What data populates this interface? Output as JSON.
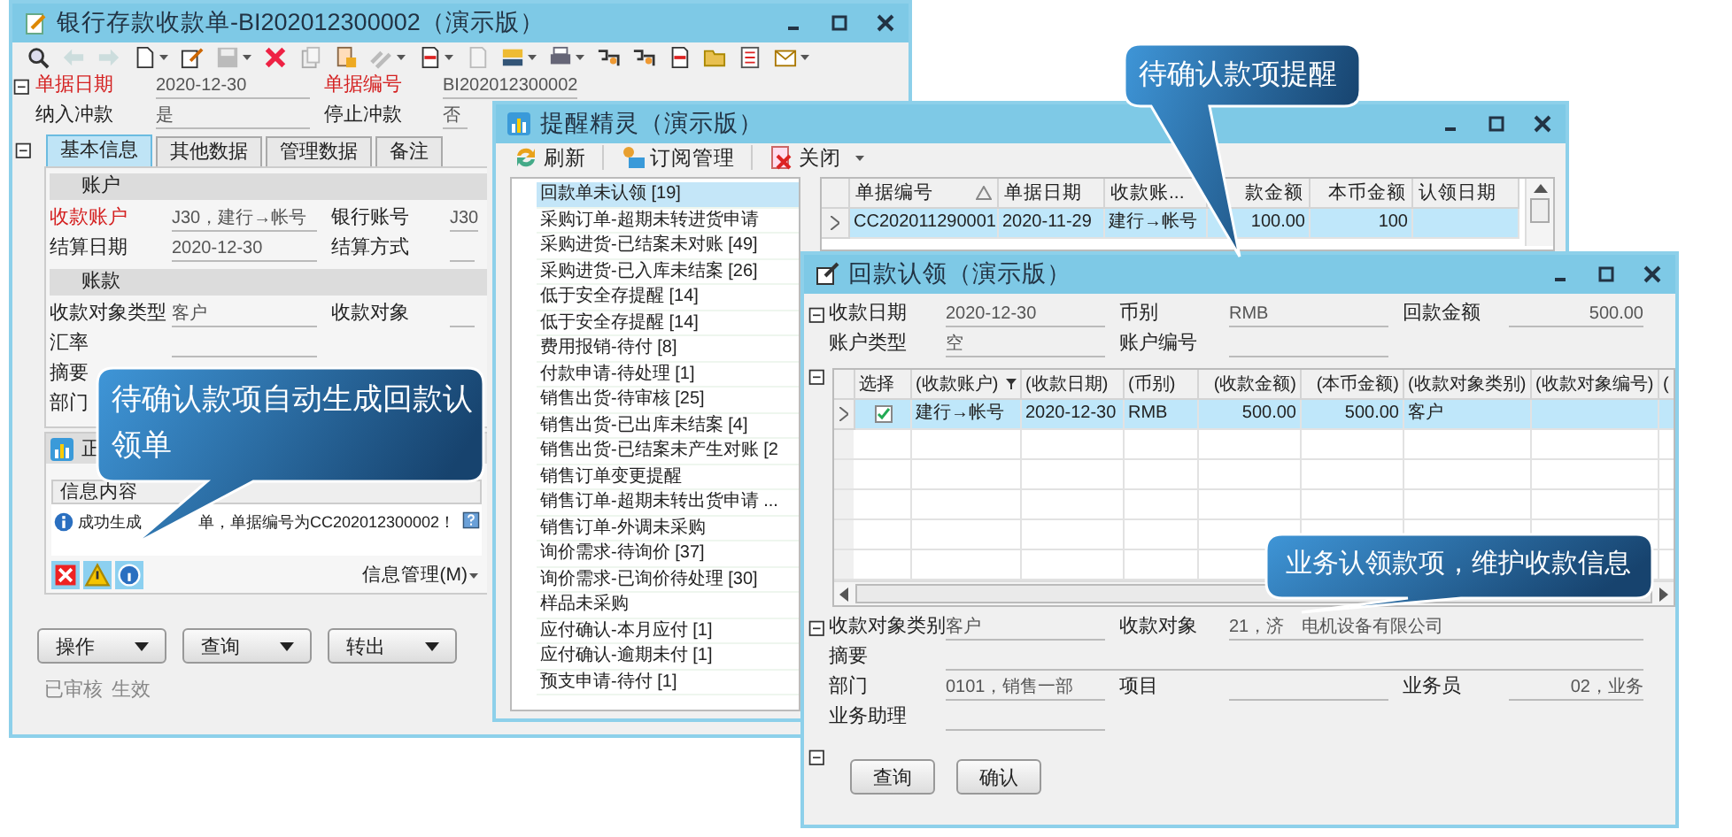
{
  "receipt_window": {
    "title": "银行存款收款单-BI202012300002（演示版）",
    "header_rows": [
      [
        {
          "label": "单据日期",
          "value": "2020-12-30",
          "required": true
        },
        {
          "label": "单据编号",
          "value": "BI202012300002",
          "required": true
        }
      ],
      [
        {
          "label": "纳入冲款",
          "value": "是",
          "required": false
        },
        {
          "label": "停止冲款",
          "value": "否",
          "required": false
        }
      ]
    ],
    "tabs": [
      {
        "label": "基本信息",
        "selected": true
      },
      {
        "label": "其他数据",
        "selected": false
      },
      {
        "label": "管理数据",
        "selected": false
      },
      {
        "label": "备注",
        "selected": false
      }
    ],
    "sections": [
      {
        "title": "账户",
        "rows": [
          [
            {
              "label": "收款账户",
              "value": "J30，建行→帐号",
              "required": true
            },
            {
              "label": "银行账号",
              "value": "J30",
              "required": false
            }
          ],
          [
            {
              "label": "结算日期",
              "value": "2020-12-30",
              "required": false
            },
            {
              "label": "结算方式",
              "required": false
            }
          ]
        ]
      },
      {
        "title": "账款",
        "rows": [
          [
            {
              "label": "收款对象类型",
              "value": "客户",
              "required": false
            },
            {
              "label": "收款对象",
              "required": false
            }
          ],
          [
            {
              "label": "汇率",
              "required": false
            }
          ],
          [
            {
              "label": "摘要",
              "required": false
            }
          ],
          [
            {
              "label": "部门",
              "required": false
            }
          ]
        ]
      }
    ],
    "message_panel": {
      "title": "正",
      "header": "信息内容",
      "message_parts": [
        "成功生成",
        "单，单据编号为CC202012300002！"
      ],
      "menu": "信息管理(M)"
    },
    "buttons": [
      "操作",
      "查询",
      "转出"
    ],
    "status": [
      "已审核",
      "生效"
    ]
  },
  "reminder_window": {
    "title": "提醒精灵（演示版）",
    "toolbar": [
      "刷新",
      "订阅管理",
      "关闭"
    ],
    "items": [
      {
        "label": "回款单未认领 [19]",
        "selected": true
      },
      {
        "label": "采购订单-超期未转进货申请",
        "selected": false
      },
      {
        "label": "采购进货-已结案未对账 [49]",
        "selected": false
      },
      {
        "label": "采购进货-已入库未结案 [26]",
        "selected": false
      },
      {
        "label": "低于安全存提醒 [14]",
        "selected": false
      },
      {
        "label": "低于安全存提醒 [14]",
        "selected": false
      },
      {
        "label": "费用报销-待付 [8]",
        "selected": false
      },
      {
        "label": "付款申请-待处理 [1]",
        "selected": false
      },
      {
        "label": "销售出货-待审核 [25]",
        "selected": false
      },
      {
        "label": "销售出货-已出库未结案 [4]",
        "selected": false
      },
      {
        "label": "销售出货-已结案未产生对账 [2",
        "selected": false
      },
      {
        "label": "销售订单变更提醒",
        "selected": false
      },
      {
        "label": "销售订单-超期未转出货申请 ...",
        "selected": false
      },
      {
        "label": "销售订单-外调未采购",
        "selected": false
      },
      {
        "label": "询价需求-待询价 [37]",
        "selected": false
      },
      {
        "label": "询价需求-已询价待处理 [30]",
        "selected": false
      },
      {
        "label": "样品未采购",
        "selected": false
      },
      {
        "label": "应付确认-本月应付 [1]",
        "selected": false
      },
      {
        "label": "应付确认-逾期未付 [1]",
        "selected": false
      },
      {
        "label": "预支申请-待付 [1]",
        "selected": false
      }
    ],
    "grid": {
      "columns": [
        {
          "label": "单据编号",
          "sorted": true
        },
        {
          "label": "单据日期",
          "sorted": false
        },
        {
          "label": "收款账...",
          "sorted": false
        },
        {
          "label": "款金额",
          "sorted": false
        },
        {
          "label": "本币金额",
          "sorted": false
        },
        {
          "label": "认领日期",
          "sorted": false
        }
      ],
      "rows": [
        {
          "selected": true,
          "cells": [
            "CC202011290001",
            "2020-11-29",
            "建行→帐号",
            "100.00",
            "100"
          ]
        }
      ]
    }
  },
  "claim_window": {
    "title": "回款认领（演示版）",
    "top_rows": [
      [
        {
          "label": "收款日期",
          "value": "2020-12-30"
        },
        {
          "label": "币别",
          "value": "RMB"
        },
        {
          "label": "回款金额",
          "value": "500.00"
        }
      ],
      [
        {
          "label": "账户类型",
          "value": "空"
        },
        {
          "label": "账户编号"
        }
      ]
    ],
    "grid": {
      "columns": [
        {
          "label": "选择",
          "filtered": false
        },
        {
          "label": "(收款账户)",
          "filtered": true
        },
        {
          "label": "(收款日期)",
          "filtered": false
        },
        {
          "label": "(币别)",
          "filtered": false
        },
        {
          "label": "(收款金额)",
          "filtered": false
        },
        {
          "label": "(本币金额)",
          "filtered": false
        },
        {
          "label": "(收款对象类别)",
          "filtered": false
        },
        {
          "label": "(收款对象编号)",
          "filtered": false
        },
        {
          "label": "(",
          "filtered": false
        }
      ],
      "rows": [
        {
          "selected": true,
          "checked": true,
          "cells": [
            "",
            "建行→帐号",
            "2020-12-30",
            "RMB",
            "500.00",
            "500.00",
            "客户"
          ]
        }
      ]
    },
    "bottom_rows": [
      [
        {
          "label": "收款对象类别",
          "value": "客户"
        },
        {
          "label": "收款对象",
          "value_parts": [
            "21，济",
            "电机设备有限公司"
          ]
        }
      ],
      [
        {
          "label": "摘要"
        }
      ],
      [
        {
          "label": "部门",
          "value": "0101，销售一部"
        },
        {
          "label": "项目"
        },
        {
          "label": "业务员",
          "value": "02，业务"
        }
      ],
      [
        {
          "label": "业务助理"
        }
      ]
    ],
    "buttons": [
      "查询",
      "确认"
    ]
  },
  "callouts": [
    {
      "text": "待确认款项自动生成回款认领单"
    },
    {
      "text": "待确认款项提醒"
    },
    {
      "text": "业务认领款项，维护收款信息"
    }
  ]
}
